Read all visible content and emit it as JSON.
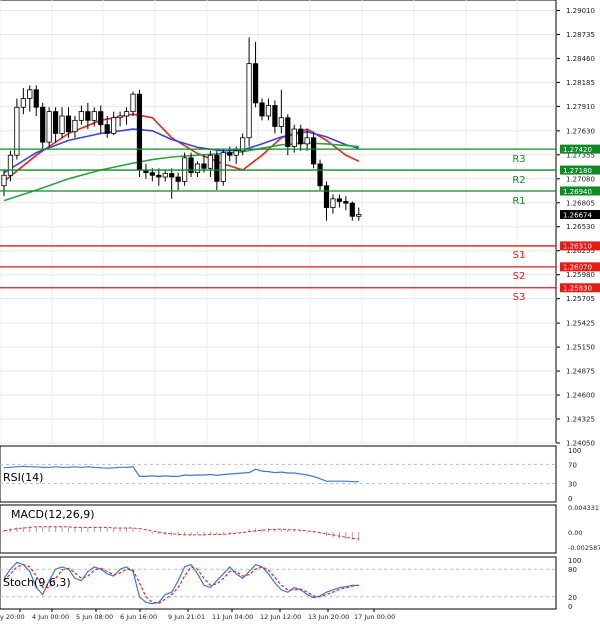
{
  "chart_data": [
    {
      "type": "candlestick",
      "title": "",
      "x_ticks": [
        "y 20:00",
        "4 Jun 00:00",
        "5 Jun 08:00",
        "6 Jun 16:00",
        "9 Jun 21:01",
        "11 Jun 04:00",
        "12 Jun 12:00",
        "13 Jun 20:00",
        "17 Jun 00:00"
      ],
      "y_ticks": [
        "1.29010",
        "1.28735",
        "1.28460",
        "1.28185",
        "1.27910",
        "1.27630",
        "1.27355",
        "1.27080",
        "1.26805",
        "1.26530",
        "1.26255",
        "1.25980",
        "1.25705",
        "1.25425",
        "1.25150",
        "1.24875",
        "1.24600",
        "1.24325",
        "1.24050"
      ],
      "ylim": [
        1.2405,
        1.2913
      ],
      "grid": true,
      "candles": [
        {
          "o": 1.27,
          "h": 1.2718,
          "l": 1.2688,
          "c": 1.2712
        },
        {
          "o": 1.2712,
          "h": 1.274,
          "l": 1.2705,
          "c": 1.2735
        },
        {
          "o": 1.2735,
          "h": 1.28,
          "l": 1.273,
          "c": 1.279
        },
        {
          "o": 1.279,
          "h": 1.2812,
          "l": 1.2782,
          "c": 1.28
        },
        {
          "o": 1.28,
          "h": 1.2815,
          "l": 1.2785,
          "c": 1.281
        },
        {
          "o": 1.281,
          "h": 1.2815,
          "l": 1.278,
          "c": 1.279
        },
        {
          "o": 1.279,
          "h": 1.2795,
          "l": 1.2742,
          "c": 1.275
        },
        {
          "o": 1.275,
          "h": 1.279,
          "l": 1.2745,
          "c": 1.2785
        },
        {
          "o": 1.2785,
          "h": 1.279,
          "l": 1.275,
          "c": 1.276
        },
        {
          "o": 1.276,
          "h": 1.279,
          "l": 1.2755,
          "c": 1.278
        },
        {
          "o": 1.278,
          "h": 1.279,
          "l": 1.2755,
          "c": 1.2762
        },
        {
          "o": 1.2762,
          "h": 1.278,
          "l": 1.2755,
          "c": 1.2775
        },
        {
          "o": 1.2775,
          "h": 1.2792,
          "l": 1.277,
          "c": 1.2785
        },
        {
          "o": 1.2785,
          "h": 1.2795,
          "l": 1.2765,
          "c": 1.2775
        },
        {
          "o": 1.2775,
          "h": 1.279,
          "l": 1.2768,
          "c": 1.2785
        },
        {
          "o": 1.2785,
          "h": 1.2792,
          "l": 1.276,
          "c": 1.277
        },
        {
          "o": 1.277,
          "h": 1.278,
          "l": 1.2755,
          "c": 1.276
        },
        {
          "o": 1.276,
          "h": 1.2785,
          "l": 1.2758,
          "c": 1.2778
        },
        {
          "o": 1.2778,
          "h": 1.2785,
          "l": 1.2768,
          "c": 1.278
        },
        {
          "o": 1.278,
          "h": 1.279,
          "l": 1.277,
          "c": 1.2785
        },
        {
          "o": 1.2785,
          "h": 1.2808,
          "l": 1.278,
          "c": 1.2805
        },
        {
          "o": 1.2805,
          "h": 1.281,
          "l": 1.271,
          "c": 1.2718
        },
        {
          "o": 1.2718,
          "h": 1.2725,
          "l": 1.2708,
          "c": 1.2715
        },
        {
          "o": 1.2715,
          "h": 1.272,
          "l": 1.2705,
          "c": 1.2712
        },
        {
          "o": 1.2712,
          "h": 1.272,
          "l": 1.27,
          "c": 1.271
        },
        {
          "o": 1.271,
          "h": 1.2718,
          "l": 1.2705,
          "c": 1.2714
        },
        {
          "o": 1.2714,
          "h": 1.272,
          "l": 1.2685,
          "c": 1.271
        },
        {
          "o": 1.271,
          "h": 1.2715,
          "l": 1.2695,
          "c": 1.2705
        },
        {
          "o": 1.2705,
          "h": 1.2738,
          "l": 1.27,
          "c": 1.2732
        },
        {
          "o": 1.2732,
          "h": 1.2738,
          "l": 1.271,
          "c": 1.2715
        },
        {
          "o": 1.2715,
          "h": 1.2728,
          "l": 1.271,
          "c": 1.2725
        },
        {
          "o": 1.2725,
          "h": 1.2735,
          "l": 1.2715,
          "c": 1.272
        },
        {
          "o": 1.272,
          "h": 1.274,
          "l": 1.271,
          "c": 1.2735
        },
        {
          "o": 1.2735,
          "h": 1.274,
          "l": 1.2695,
          "c": 1.2705
        },
        {
          "o": 1.2705,
          "h": 1.2742,
          "l": 1.27,
          "c": 1.2738
        },
        {
          "o": 1.2738,
          "h": 1.2745,
          "l": 1.2728,
          "c": 1.2735
        },
        {
          "o": 1.2735,
          "h": 1.2745,
          "l": 1.2725,
          "c": 1.274
        },
        {
          "o": 1.274,
          "h": 1.276,
          "l": 1.2735,
          "c": 1.2755
        },
        {
          "o": 1.2755,
          "h": 1.287,
          "l": 1.2745,
          "c": 1.284
        },
        {
          "o": 1.284,
          "h": 1.2865,
          "l": 1.279,
          "c": 1.2795
        },
        {
          "o": 1.2795,
          "h": 1.28,
          "l": 1.2775,
          "c": 1.278
        },
        {
          "o": 1.278,
          "h": 1.28,
          "l": 1.2775,
          "c": 1.2792
        },
        {
          "o": 1.2792,
          "h": 1.2798,
          "l": 1.276,
          "c": 1.2768
        },
        {
          "o": 1.2768,
          "h": 1.281,
          "l": 1.276,
          "c": 1.2778
        },
        {
          "o": 1.2778,
          "h": 1.2782,
          "l": 1.2735,
          "c": 1.2745
        },
        {
          "o": 1.2745,
          "h": 1.277,
          "l": 1.2738,
          "c": 1.2765
        },
        {
          "o": 1.2765,
          "h": 1.277,
          "l": 1.274,
          "c": 1.2748
        },
        {
          "o": 1.2748,
          "h": 1.2765,
          "l": 1.274,
          "c": 1.2755
        },
        {
          "o": 1.2755,
          "h": 1.2762,
          "l": 1.272,
          "c": 1.2725
        },
        {
          "o": 1.2725,
          "h": 1.273,
          "l": 1.2695,
          "c": 1.27
        },
        {
          "o": 1.27,
          "h": 1.2705,
          "l": 1.266,
          "c": 1.2675
        },
        {
          "o": 1.2675,
          "h": 1.269,
          "l": 1.2668,
          "c": 1.2685
        },
        {
          "o": 1.2685,
          "h": 1.269,
          "l": 1.2675,
          "c": 1.2682
        },
        {
          "o": 1.2682,
          "h": 1.2688,
          "l": 1.2672,
          "c": 1.268
        },
        {
          "o": 1.268,
          "h": 1.2682,
          "l": 1.266,
          "c": 1.2665
        },
        {
          "o": 1.2665,
          "h": 1.2675,
          "l": 1.266,
          "c": 1.2667
        }
      ],
      "moving_averages": [
        {
          "color": "#e8261e",
          "points": [
            [
              0,
              1.2705
            ],
            [
              5,
              1.2735
            ],
            [
              10,
              1.276
            ],
            [
              15,
              1.2775
            ],
            [
              20,
              1.2782
            ],
            [
              23,
              1.2778
            ],
            [
              26,
              1.2755
            ],
            [
              30,
              1.2737
            ],
            [
              34,
              1.2725
            ],
            [
              37,
              1.2718
            ],
            [
              40,
              1.2735
            ],
            [
              43,
              1.2755
            ],
            [
              47,
              1.2765
            ],
            [
              50,
              1.2752
            ],
            [
              53,
              1.2735
            ],
            [
              55,
              1.2728
            ]
          ]
        },
        {
          "color": "#3a46d6",
          "points": [
            [
              0,
              1.2715
            ],
            [
              5,
              1.2738
            ],
            [
              10,
              1.2752
            ],
            [
              15,
              1.276
            ],
            [
              20,
              1.2765
            ],
            [
              23,
              1.2763
            ],
            [
              26,
              1.2753
            ],
            [
              30,
              1.2744
            ],
            [
              34,
              1.274
            ],
            [
              37,
              1.2741
            ],
            [
              40,
              1.2748
            ],
            [
              43,
              1.2756
            ],
            [
              47,
              1.2762
            ],
            [
              50,
              1.2756
            ],
            [
              53,
              1.2747
            ],
            [
              55,
              1.2743
            ]
          ]
        },
        {
          "color": "#2aa640",
          "points": [
            [
              0,
              1.2683
            ],
            [
              5,
              1.2695
            ],
            [
              10,
              1.2708
            ],
            [
              15,
              1.2718
            ],
            [
              20,
              1.2726
            ],
            [
              23,
              1.273
            ],
            [
              26,
              1.2733
            ],
            [
              30,
              1.2735
            ],
            [
              34,
              1.2737
            ],
            [
              37,
              1.2739
            ],
            [
              40,
              1.2743
            ],
            [
              43,
              1.2747
            ],
            [
              47,
              1.2749
            ],
            [
              50,
              1.2748
            ],
            [
              53,
              1.2746
            ],
            [
              55,
              1.2745
            ]
          ]
        }
      ],
      "levels": [
        {
          "name": "R3",
          "value": 1.2742,
          "label": "1.27420",
          "color": "#0f8a25"
        },
        {
          "name": "R2",
          "value": 1.2718,
          "label": "1.27180",
          "color": "#0f8a25"
        },
        {
          "name": "R1",
          "value": 1.2694,
          "label": "1.26940",
          "color": "#0f8a25"
        },
        {
          "name": "S1",
          "value": 1.2631,
          "label": "1.26310",
          "color": "#e81a14"
        },
        {
          "name": "S2",
          "value": 1.2607,
          "label": "1.26070",
          "color": "#e81a14"
        },
        {
          "name": "S3",
          "value": 1.2583,
          "label": "1.25830",
          "color": "#e81a14"
        }
      ],
      "current_price": "1.26674"
    },
    {
      "type": "line",
      "title": "RSI(14)",
      "ylim": [
        0,
        100
      ],
      "y_ticks": [
        "100",
        "70",
        "30",
        "0"
      ],
      "color": "#3a7ad8",
      "values": [
        63,
        64,
        65,
        66,
        65,
        65,
        64,
        64,
        65,
        64,
        64,
        65,
        64,
        65,
        64,
        63,
        62,
        63,
        64,
        64,
        65,
        45,
        45,
        46,
        45,
        46,
        45,
        45,
        48,
        47,
        48,
        48,
        49,
        47,
        49,
        50,
        51,
        52,
        53,
        60,
        56,
        55,
        53,
        54,
        52,
        52,
        50,
        48,
        45,
        40,
        35,
        35,
        35,
        35,
        34,
        34
      ]
    },
    {
      "type": "histogram_line",
      "title": "MACD(12,26,9)",
      "y_ticks": [
        "0.004331",
        "0.00",
        "-0.002587"
      ],
      "ylim": [
        -0.002587,
        0.004331
      ],
      "histogram_color": "#a0a0a0",
      "signal_color": "#e8261e",
      "histogram": [
        0.0004,
        0.0006,
        0.0008,
        0.0009,
        0.001,
        0.001,
        0.0009,
        0.0009,
        0.0009,
        0.0009,
        0.0008,
        0.0008,
        0.0008,
        0.0008,
        0.0008,
        0.0008,
        0.0007,
        0.0007,
        0.0007,
        0.0007,
        0.0007,
        0.0002,
        -0.0001,
        -0.0003,
        -0.0004,
        -0.0005,
        -0.0006,
        -0.0006,
        -0.0005,
        -0.0005,
        -0.0004,
        -0.0004,
        -0.0003,
        -0.0004,
        -0.0003,
        -0.0002,
        -0.0001,
        0.0,
        0.0005,
        0.0006,
        0.0006,
        0.0006,
        0.0005,
        0.0005,
        0.0004,
        0.0003,
        0.0002,
        0.0001,
        -0.0001,
        -0.0004,
        -0.0007,
        -0.0009,
        -0.0011,
        -0.0012,
        -0.0014,
        -0.0015
      ],
      "signal": [
        0.0002,
        0.0004,
        0.0006,
        0.0007,
        0.0008,
        0.0009,
        0.0009,
        0.0009,
        0.0009,
        0.0009,
        0.0009,
        0.0008,
        0.0008,
        0.0008,
        0.0008,
        0.0008,
        0.0008,
        0.0007,
        0.0007,
        0.0007,
        0.0007,
        0.0006,
        0.0004,
        0.0002,
        0.0,
        -0.0002,
        -0.0003,
        -0.0004,
        -0.0005,
        -0.0005,
        -0.0005,
        -0.0005,
        -0.0004,
        -0.0004,
        -0.0004,
        -0.0003,
        -0.0002,
        -0.0001,
        0.0001,
        0.0002,
        0.0003,
        0.0004,
        0.0005,
        0.0005,
        0.0004,
        0.0004,
        0.0003,
        0.0002,
        0.0001,
        -0.0001,
        -0.0003,
        -0.0005,
        -0.0007,
        -0.0009,
        -0.0011,
        -0.0012
      ]
    },
    {
      "type": "line",
      "title": "Stoch(9,6,3)",
      "ylim": [
        0,
        100
      ],
      "y_ticks": [
        "100",
        "80",
        "20",
        "0"
      ],
      "series": [
        {
          "color": "#3a7ad8",
          "values": [
            60,
            80,
            95,
            90,
            75,
            40,
            25,
            55,
            80,
            85,
            80,
            60,
            55,
            75,
            85,
            80,
            70,
            65,
            80,
            85,
            75,
            20,
            8,
            5,
            8,
            25,
            30,
            55,
            85,
            90,
            70,
            45,
            40,
            55,
            70,
            85,
            70,
            60,
            75,
            90,
            85,
            70,
            50,
            35,
            30,
            40,
            35,
            25,
            18,
            22,
            30,
            35,
            40,
            42,
            45,
            45
          ]
        },
        {
          "color": "#e8261e",
          "dashed": true,
          "values": [
            55,
            70,
            85,
            90,
            85,
            65,
            40,
            40,
            60,
            78,
            82,
            72,
            60,
            65,
            78,
            82,
            75,
            68,
            72,
            80,
            78,
            50,
            20,
            8,
            6,
            15,
            25,
            40,
            65,
            85,
            80,
            60,
            45,
            48,
            60,
            75,
            75,
            65,
            68,
            80,
            85,
            78,
            62,
            45,
            35,
            35,
            37,
            30,
            22,
            20,
            25,
            30,
            36,
            40,
            43,
            45
          ]
        }
      ]
    }
  ]
}
